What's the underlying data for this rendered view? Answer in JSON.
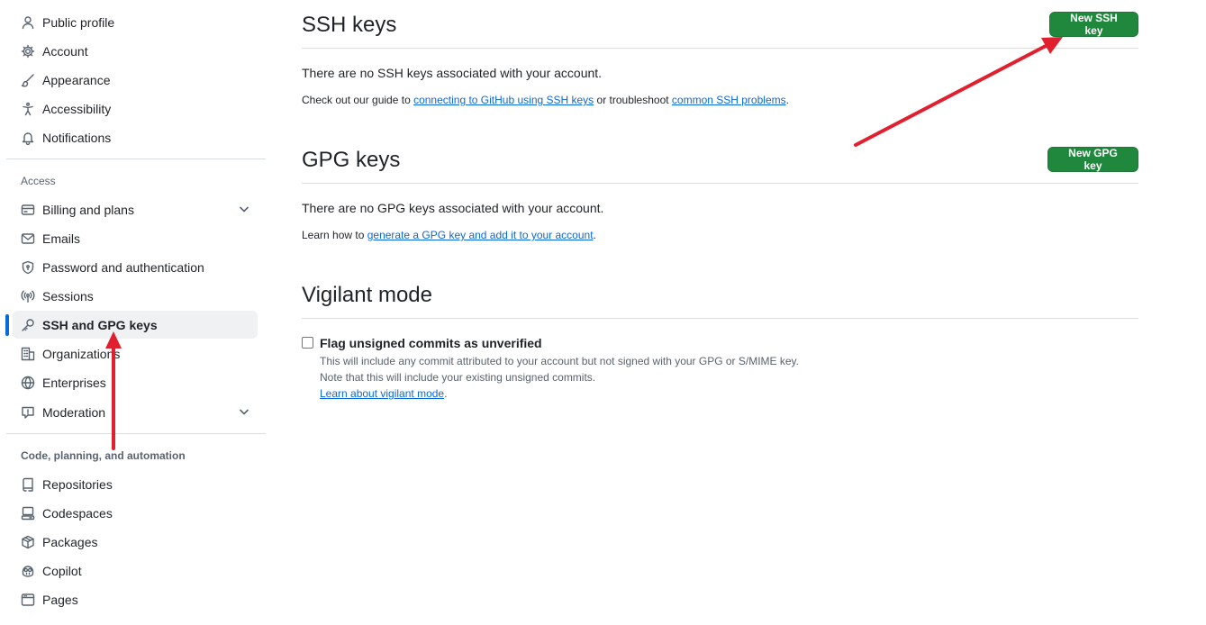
{
  "sidebar": {
    "items_top": [
      {
        "label": "Public profile",
        "icon": "person-icon"
      },
      {
        "label": "Account",
        "icon": "gear-icon"
      },
      {
        "label": "Appearance",
        "icon": "paintbrush-icon"
      },
      {
        "label": "Accessibility",
        "icon": "accessibility-icon"
      },
      {
        "label": "Notifications",
        "icon": "bell-icon"
      }
    ],
    "access_heading": "Access",
    "items_access": [
      {
        "label": "Billing and plans",
        "icon": "credit-card-icon",
        "expandable": true
      },
      {
        "label": "Emails",
        "icon": "mail-icon"
      },
      {
        "label": "Password and authentication",
        "icon": "shield-lock-icon"
      },
      {
        "label": "Sessions",
        "icon": "broadcast-icon"
      },
      {
        "label": "SSH and GPG keys",
        "icon": "key-icon",
        "active": true
      },
      {
        "label": "Organizations",
        "icon": "organization-icon"
      },
      {
        "label": "Enterprises",
        "icon": "globe-icon"
      },
      {
        "label": "Moderation",
        "icon": "report-icon",
        "expandable": true
      }
    ],
    "code_heading": "Code, planning, and automation",
    "items_code": [
      {
        "label": "Repositories",
        "icon": "repo-icon"
      },
      {
        "label": "Codespaces",
        "icon": "codespaces-icon"
      },
      {
        "label": "Packages",
        "icon": "package-icon"
      },
      {
        "label": "Copilot",
        "icon": "copilot-icon"
      },
      {
        "label": "Pages",
        "icon": "browser-icon"
      }
    ]
  },
  "ssh": {
    "title": "SSH keys",
    "button": "New SSH key",
    "empty_text": "There are no SSH keys associated with your account.",
    "guide_prefix": "Check out our guide to ",
    "guide_link": "connecting to GitHub using SSH keys",
    "guide_mid": " or troubleshoot ",
    "problems_link": "common SSH problems",
    "guide_suffix": "."
  },
  "gpg": {
    "title": "GPG keys",
    "button": "New GPG key",
    "empty_text": "There are no GPG keys associated with your account.",
    "learn_prefix": "Learn how to ",
    "learn_link": "generate a GPG key and add it to your account",
    "learn_suffix": "."
  },
  "vigilant": {
    "title": "Vigilant mode",
    "checkbox_label": "Flag unsigned commits as unverified",
    "checked": false,
    "note1": "This will include any commit attributed to your account but not signed with your GPG or S/MIME key.",
    "note2": "Note that this will include your existing unsigned commits.",
    "learn_link": "Learn about vigilant mode",
    "learn_suffix": "."
  },
  "colors": {
    "primary_button": "#1f883d",
    "link": "#0969da",
    "active_indicator": "#0969da",
    "annotation_arrow": "#e0202e"
  }
}
